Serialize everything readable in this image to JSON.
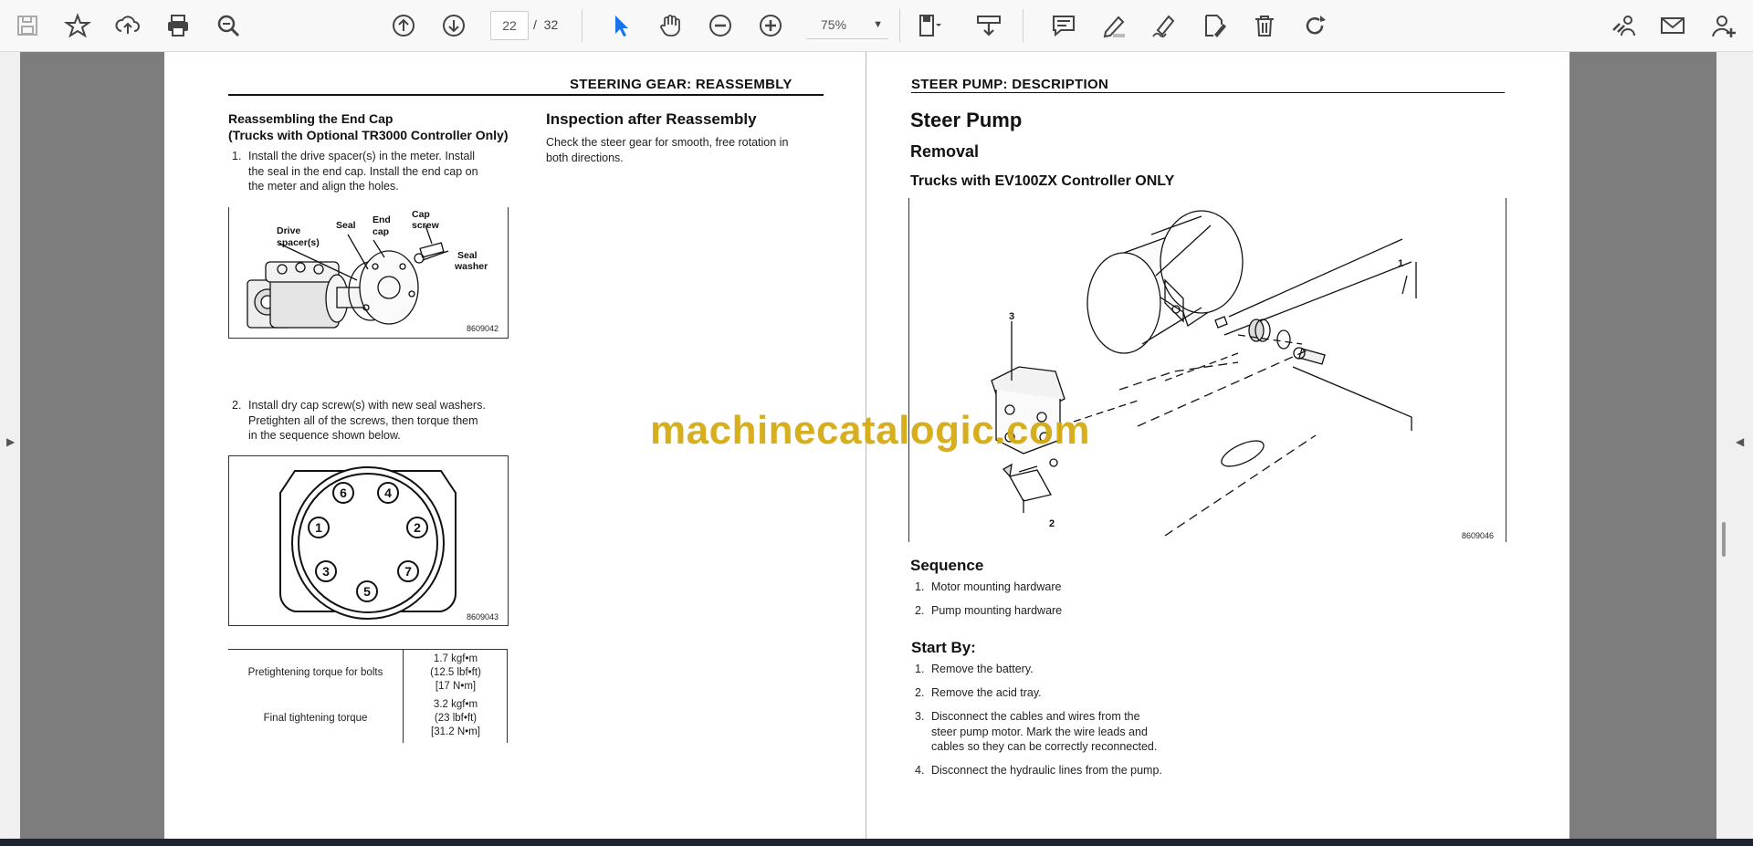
{
  "toolbar": {
    "page_current": "22",
    "page_separator": "/",
    "page_total": "32",
    "zoom": "75%",
    "icons": [
      "save-icon",
      "bookmark-star-icon",
      "upload-cloud-icon",
      "print-icon",
      "search-zoom-icon",
      "page-up-icon",
      "page-down-icon",
      "zoom-out-icon",
      "zoom-in-icon",
      "select-cursor-icon",
      "hand-pan-icon",
      "fit-page-icon",
      "download-tray-icon",
      "comment-icon",
      "highlight-pen-icon",
      "sign-pen-icon",
      "edit-document-icon",
      "trash-icon",
      "rotate-icon",
      "link-user-icon",
      "mail-icon",
      "add-user-icon"
    ]
  },
  "left_page": {
    "header": "STEERING GEAR: REASSEMBLY",
    "section1_title": "Reassembling the End Cap",
    "section1_subtitle": "(Trucks with Optional TR3000 Controller Only)",
    "step1_num": "1.",
    "step1_lines": [
      "Install the drive spacer(s) in the meter. Install",
      "the seal in the end cap. Install the end cap on",
      "the meter and align the holes."
    ],
    "fig1": {
      "labels": {
        "drive": "Drive",
        "spacers": "spacer(s)",
        "seal": "Seal",
        "end": "End",
        "cap": "cap",
        "capscrew1": "Cap",
        "capscrew2": "screw",
        "sealwasher1": "Seal",
        "sealwasher2": "washer"
      },
      "id": "8609042"
    },
    "step2_num": "2.",
    "step2_lines": [
      "Install dry cap screw(s) with new seal washers.",
      "Pretighten all of the screws, then torque them",
      "in the sequence shown below."
    ],
    "fig2": {
      "bolts": [
        "6",
        "4",
        "1",
        "2",
        "3",
        "7",
        "5"
      ],
      "id": "8609043"
    },
    "table": {
      "row1_label": "Pretightening torque for bolts",
      "row1_values": [
        "1.7 kgf•m",
        "(12.5 lbf•ft)",
        "[17 N•m]"
      ],
      "row2_label": "Final tightening torque",
      "row2_values": [
        "3.2 kgf•m",
        "(23 lbf•ft)",
        "[31.2 N•m]"
      ]
    },
    "inspection_title": "Inspection after Reassembly",
    "inspection_lines": [
      "Check the steer gear for smooth, free rotation in",
      "both directions."
    ]
  },
  "right_page": {
    "header": "STEER PUMP: DESCRIPTION",
    "title": "Steer Pump",
    "subtitle": "Removal",
    "subsubtitle": "Trucks with EV100ZX Controller ONLY",
    "fig": {
      "callouts": [
        "1",
        "2",
        "3"
      ],
      "id": "8609046"
    },
    "sequence_title": "Sequence",
    "sequence": [
      {
        "num": "1.",
        "text": "Motor mounting hardware"
      },
      {
        "num": "2.",
        "text": "Pump mounting hardware"
      }
    ],
    "startby_title": "Start By:",
    "startby": [
      {
        "num": "1.",
        "lines": [
          "Remove the battery."
        ]
      },
      {
        "num": "2.",
        "lines": [
          "Remove the acid tray."
        ]
      },
      {
        "num": "3.",
        "lines": [
          "Disconnect the cables and wires from the",
          "steer pump motor. Mark the wire leads and",
          "cables so they can be correctly reconnected."
        ]
      },
      {
        "num": "4.",
        "lines": [
          "Disconnect the hydraulic lines from the pump."
        ]
      }
    ]
  },
  "watermark": "machinecatalogic.com",
  "colors": {
    "watermark": "#d4aa12",
    "cursor_active": "#1a73e8",
    "toolbar_bg": "#f8f8f8"
  }
}
